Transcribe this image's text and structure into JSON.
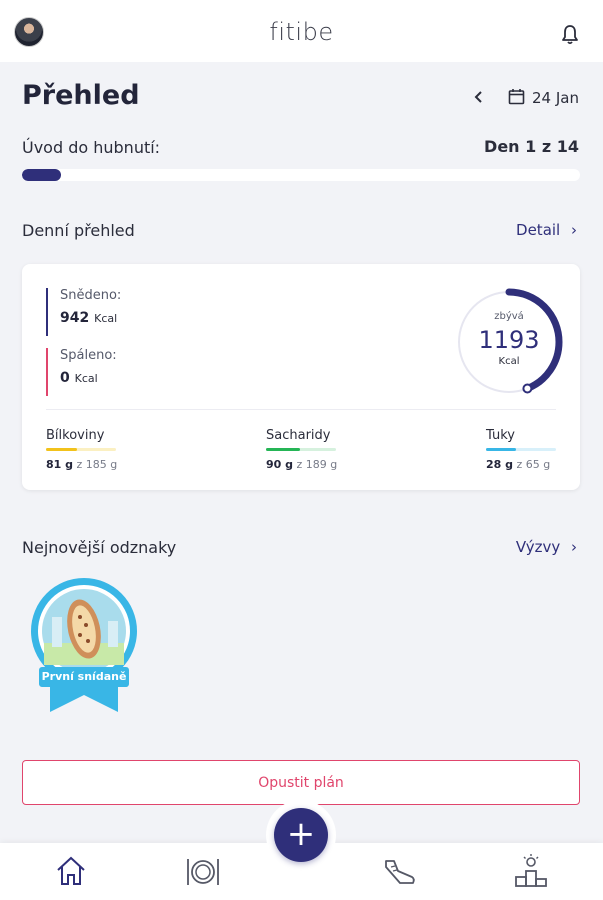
{
  "header": {
    "app_title": "fitibe",
    "avatar": "user-avatar",
    "notification_icon": "bell-icon"
  },
  "overview": {
    "title": "Přehled",
    "date": "24 Jan",
    "prev_icon": "chevron-left-icon",
    "calendar_icon": "calendar-icon"
  },
  "plan": {
    "label": "Úvod do hubnutí:",
    "day_text": "Den 1 z 14",
    "progress": 0.07
  },
  "daily": {
    "title": "Denní přehled",
    "link": "Detail",
    "eaten": {
      "label": "Snědeno:",
      "value": "942",
      "unit": "Kcal"
    },
    "burned": {
      "label": "Spáleno:",
      "value": "0",
      "unit": "Kcal"
    },
    "remaining": {
      "label": "zbývá",
      "value": "1193",
      "unit": "Kcal",
      "fraction": 0.44
    },
    "macros": [
      {
        "name": "Bílkoviny",
        "amount": "81 g",
        "target": "z 185 g",
        "fraction": 0.44,
        "color": "#f2c21b",
        "track": "#fbf0c2"
      },
      {
        "name": "Sacharidy",
        "amount": "90 g",
        "target": "z 189 g",
        "fraction": 0.48,
        "color": "#25b556",
        "track": "#d6f1de"
      },
      {
        "name": "Tuky",
        "amount": "28 g",
        "target": "z 65 g",
        "fraction": 0.43,
        "color": "#38b6e6",
        "track": "#d8f0fa"
      }
    ]
  },
  "badges": {
    "title": "Nejnovější odznaky",
    "link": "Výzvy",
    "items": [
      {
        "label": "První snídaně"
      }
    ]
  },
  "leave_button": "Opustit plán",
  "colors": {
    "primary": "#2f2f7a",
    "danger": "#e0456c",
    "background": "#f2f3f7"
  },
  "nav": {
    "add_label": "+",
    "items": [
      "home-icon",
      "meal-plate-icon",
      "add-icon",
      "exercise-shoe-icon",
      "podium-icon"
    ]
  }
}
